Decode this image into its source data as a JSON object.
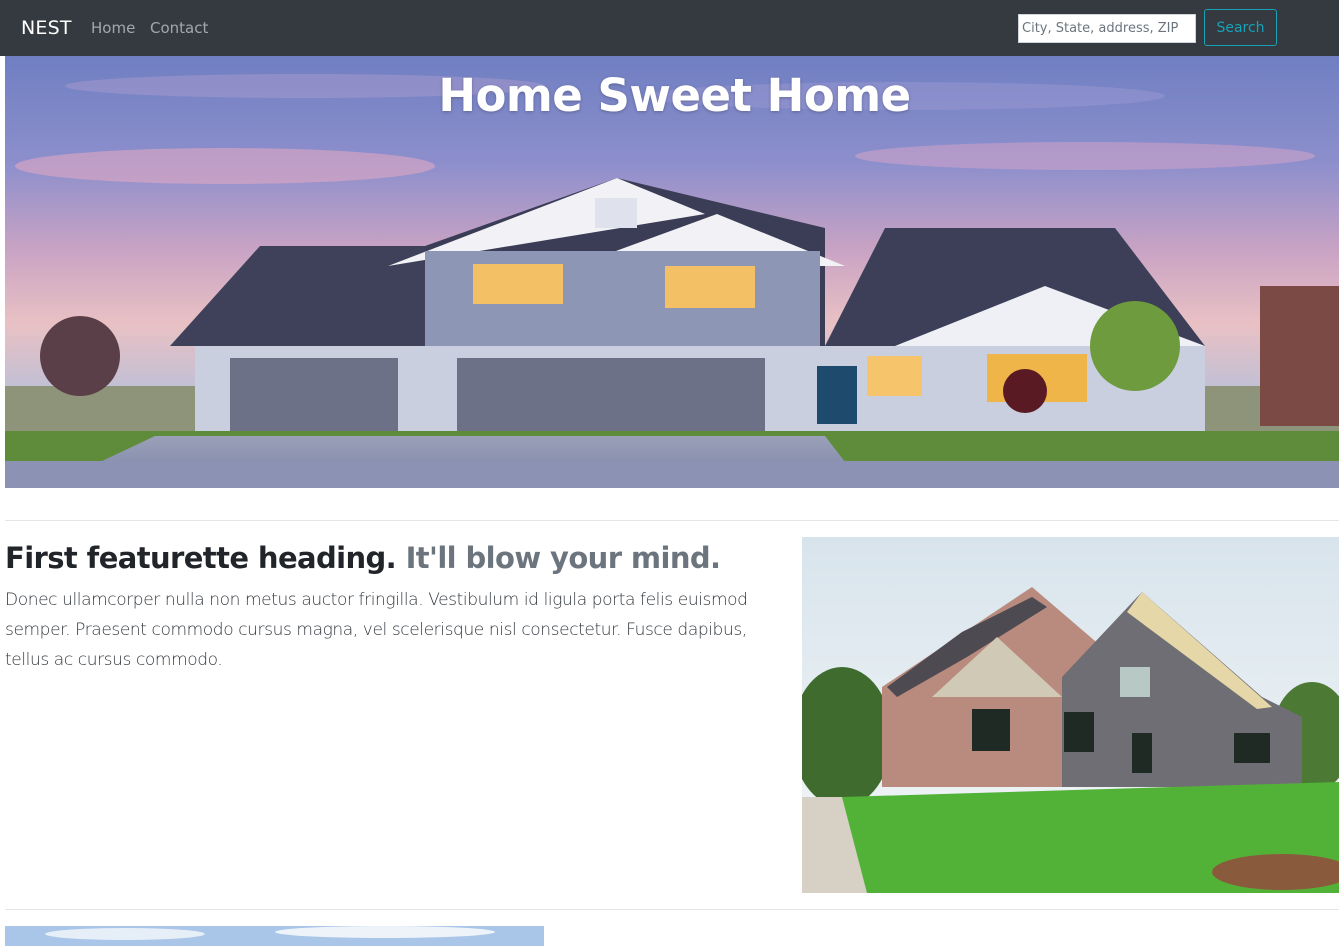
{
  "navbar": {
    "brand": "NEST",
    "links": [
      {
        "label": "Home"
      },
      {
        "label": "Contact"
      }
    ],
    "search": {
      "placeholder": "City, State, address, ZIP",
      "button_label": "Search"
    }
  },
  "hero": {
    "title": "Home Sweet Home"
  },
  "featurette_1": {
    "heading": "First featurette heading.",
    "heading_muted": "It'll blow your mind.",
    "text": "Donec ullamcorper nulla non metus auctor fringilla. Vestibulum id ligula porta felis euismod semper. Praesent commodo cursus magna, vel scelerisque nisl consectetur. Fusce dapibus, tellus ac cursus commodo."
  },
  "colors": {
    "navbar_bg": "#343a40",
    "search_accent": "#17a2b8",
    "heading_text": "#212529",
    "muted_text": "#6c757d"
  }
}
